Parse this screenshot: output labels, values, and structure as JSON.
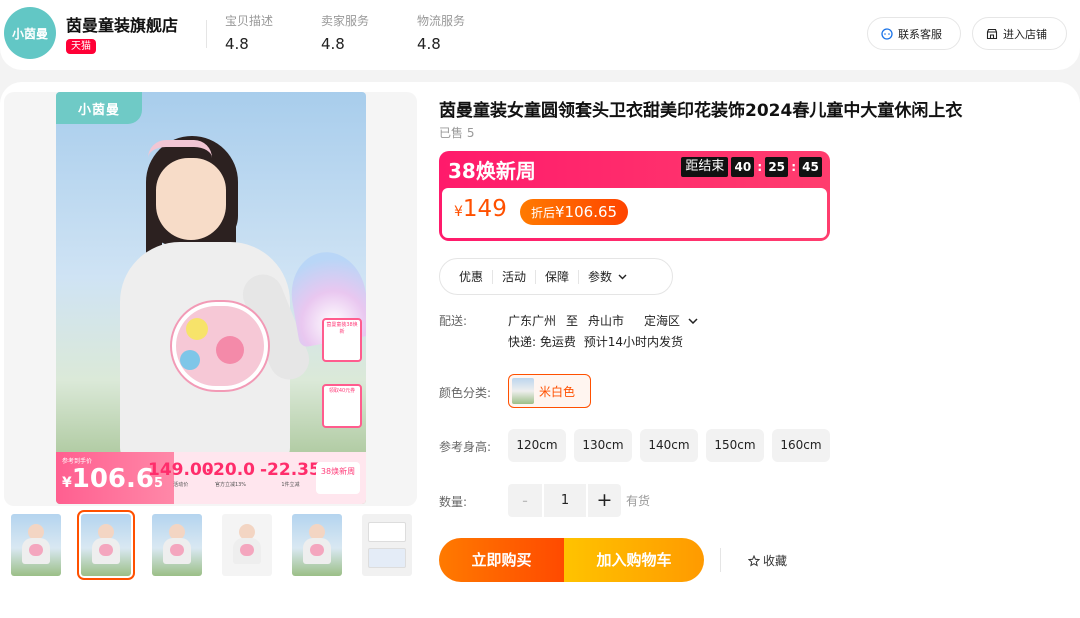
{
  "store": {
    "logo_text": "小茵曼",
    "name": "茵曼童装旗舰店",
    "badge": "天猫",
    "ratings": [
      {
        "label": "宝贝描述",
        "value": "4.8"
      },
      {
        "label": "卖家服务",
        "value": "4.8"
      },
      {
        "label": "物流服务",
        "value": "4.8"
      }
    ],
    "contact_label": "联系客服",
    "enter_label": "进入店铺"
  },
  "gallery": {
    "brand_tag": "小茵曼",
    "promo_tag": "参考到手价",
    "promo_currency": "¥",
    "promo_int": "106.6",
    "promo_dec": "5",
    "promo_cols": [
      {
        "value": "149.00",
        "label": "活动价"
      },
      {
        "value": "-20.0",
        "label": "官方立减13%"
      },
      {
        "value": "-22.35",
        "label": "1件立减"
      }
    ],
    "promo_fest": "38焕新周",
    "side_card_1": "茵曼童装38焕新",
    "side_card_2": "领取40元券",
    "thumbnails": [
      {
        "kind": "girl",
        "selected": false
      },
      {
        "kind": "girl",
        "selected": true
      },
      {
        "kind": "girl",
        "selected": false
      },
      {
        "kind": "girl",
        "selected": false
      },
      {
        "kind": "girl",
        "selected": false
      },
      {
        "kind": "detail",
        "selected": false
      }
    ]
  },
  "product": {
    "title": "茵曼童装女童圆领套头卫衣甜美印花装饰2024春儿童中大童休闲上衣",
    "sold": "已售 5"
  },
  "promo": {
    "name": "38焕新周",
    "countdown_label": "距结束",
    "hours": "40",
    "minutes": "25",
    "seconds": "45",
    "price_currency": "¥",
    "price": "149",
    "after_prefix": "折后",
    "after_price": "¥106.65"
  },
  "tabs": [
    "优惠",
    "活动",
    "保障",
    "参数"
  ],
  "shipping": {
    "label": "配送:",
    "from": "广东广州",
    "to_word": "至",
    "city": "舟山市",
    "district": "定海区",
    "express": "快递: 免运费",
    "eta": "预计14小时内发货"
  },
  "color": {
    "label": "颜色分类:",
    "option": "米白色"
  },
  "height": {
    "label": "参考身高:",
    "options": [
      "120cm",
      "130cm",
      "140cm",
      "150cm",
      "160cm"
    ]
  },
  "quantity": {
    "label": "数量:",
    "minus": "-",
    "value": "1",
    "plus": "+",
    "stock": "有货"
  },
  "actions": {
    "buy_now": "立即购买",
    "add_cart": "加入购物车",
    "favorite": "收藏"
  },
  "colors": {
    "accent": "#ff5000",
    "promo_pink": "#ff1a6b",
    "tmall_red": "#ff0036",
    "brand_teal": "#62c7c5",
    "cart_yellow": "#ffc300"
  }
}
